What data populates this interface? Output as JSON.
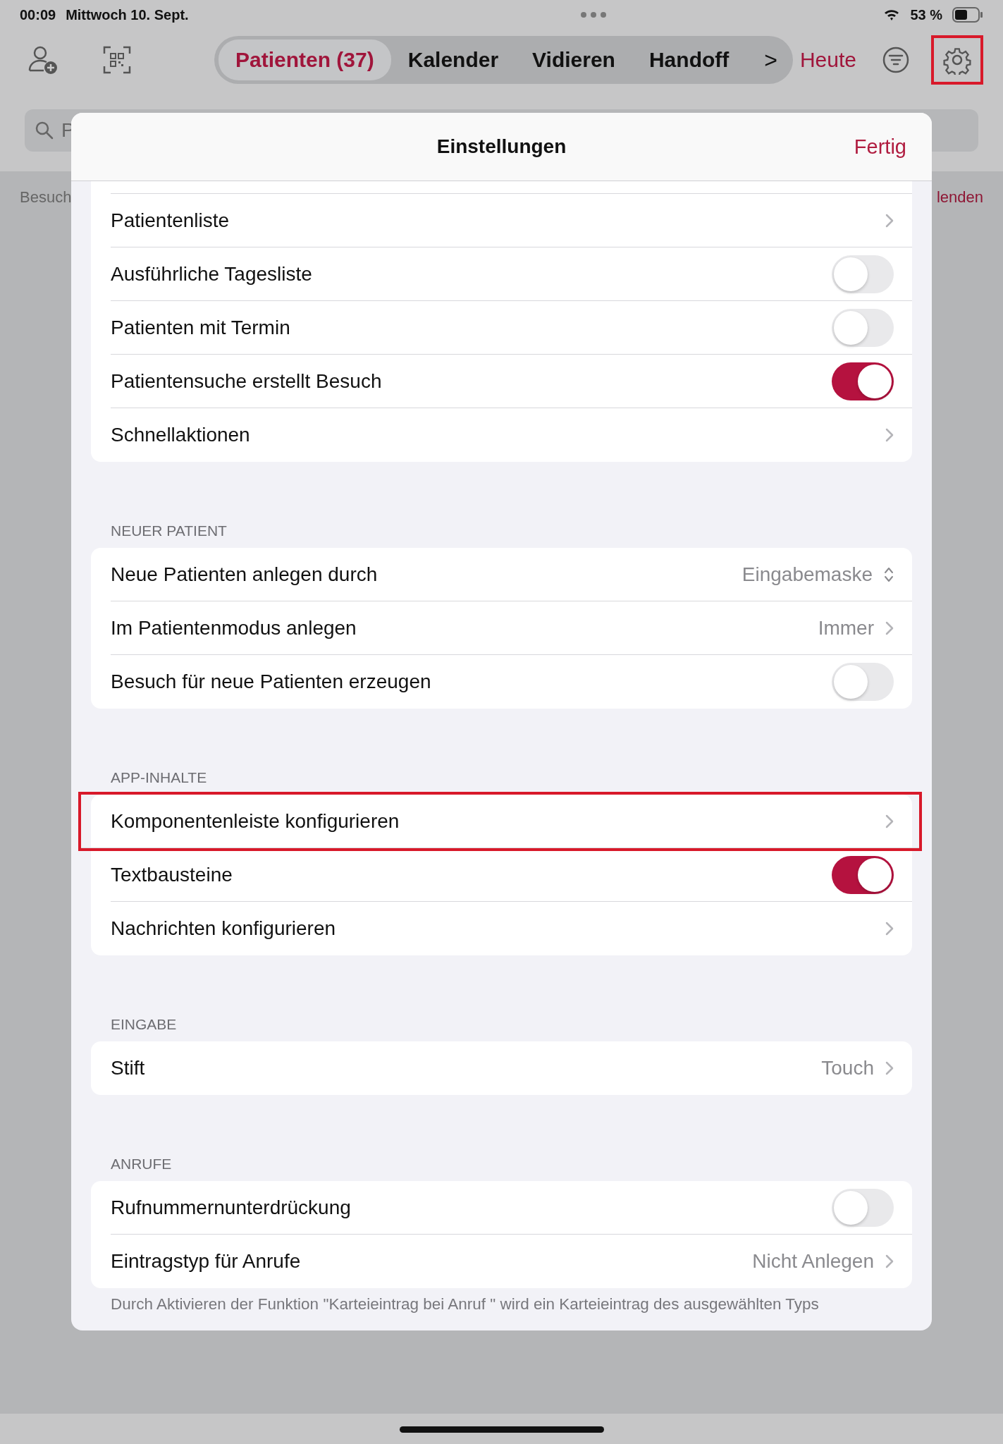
{
  "status_bar": {
    "time": "00:09",
    "date": "Mittwoch 10. Sept.",
    "battery": "53 %"
  },
  "toolbar": {
    "segments": [
      {
        "label": "Patienten (37)",
        "selected": true
      },
      {
        "label": "Kalender",
        "selected": false
      },
      {
        "label": "Vidieren",
        "selected": false
      },
      {
        "label": "Handoff",
        "selected": false
      }
    ],
    "more": ">",
    "today": "Heute",
    "settings_highlighted": true
  },
  "search": {
    "placeholder": "P"
  },
  "background": {
    "left_text": "Besuch",
    "right_text": "lenden"
  },
  "dialog": {
    "title": "Einstellungen",
    "done": "Fertig",
    "sections": [
      {
        "rows": [
          {
            "kind": "link",
            "label": "Patientenliste",
            "highlighted": false
          },
          {
            "kind": "toggle",
            "label": "Ausführliche Tagesliste",
            "on": false
          },
          {
            "kind": "toggle",
            "label": "Patienten mit Termin",
            "on": false
          },
          {
            "kind": "toggle",
            "label": "Patientensuche erstellt Besuch",
            "on": true
          },
          {
            "kind": "link",
            "label": "Schnellaktionen",
            "highlighted": false
          }
        ]
      },
      {
        "header": "NEUER PATIENT",
        "rows": [
          {
            "kind": "picker",
            "label": "Neue Patienten anlegen durch",
            "value": "Eingabemaske"
          },
          {
            "kind": "link",
            "label": "Im Patientenmodus anlegen",
            "value": "Immer",
            "highlighted": false
          },
          {
            "kind": "toggle",
            "label": "Besuch für neue Patienten erzeugen",
            "on": false
          }
        ]
      },
      {
        "header": "APP-INHALTE",
        "rows": [
          {
            "kind": "link",
            "label": "Komponentenleiste konfigurieren",
            "highlighted": true
          },
          {
            "kind": "toggle",
            "label": "Textbausteine",
            "on": true
          },
          {
            "kind": "link",
            "label": "Nachrichten konfigurieren",
            "highlighted": false
          }
        ]
      },
      {
        "header": "EINGABE",
        "rows": [
          {
            "kind": "link",
            "label": "Stift",
            "value": "Touch",
            "highlighted": false
          }
        ]
      },
      {
        "header": "ANRUFE",
        "rows": [
          {
            "kind": "toggle",
            "label": "Rufnummernunterdrückung",
            "on": false
          },
          {
            "kind": "link",
            "label": "Eintragstyp für Anrufe",
            "value": "Nicht Anlegen",
            "highlighted": false
          }
        ]
      }
    ],
    "footnote": "Durch Aktivieren der Funktion \"Karteieintrag bei Anruf \" wird ein Karteieintrag des ausgewählten Typs"
  }
}
